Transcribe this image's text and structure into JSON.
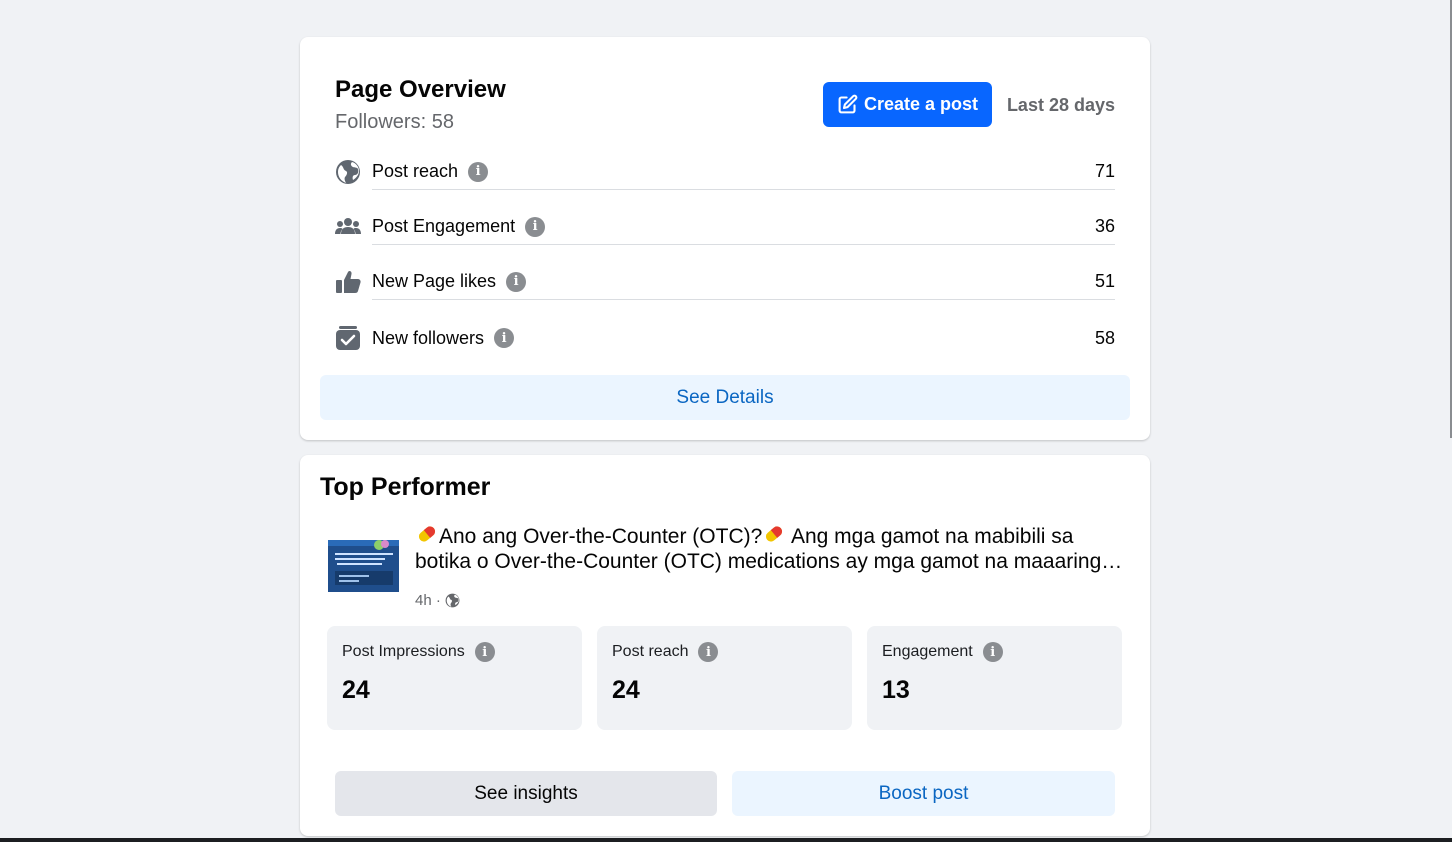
{
  "overview": {
    "title": "Page Overview",
    "subtitle": "Followers: 58",
    "create_post_label": "Create a post",
    "date_range": "Last 28 days",
    "metrics": [
      {
        "label": "Post reach",
        "value": "71",
        "icon": "globe-icon"
      },
      {
        "label": "Post Engagement",
        "value": "36",
        "icon": "people-icon"
      },
      {
        "label": "New Page likes",
        "value": "51",
        "icon": "thumbs-up-icon"
      },
      {
        "label": "New followers",
        "value": "58",
        "icon": "follow-check-icon"
      }
    ],
    "see_details_label": "See Details"
  },
  "top_performer": {
    "title": "Top Performer",
    "post_text_1": "Ano ang Over-the-Counter (OTC)?",
    "post_text_2": " Ang mga gamot na mabibili sa botika o Over-the-Counter (OTC) medications ay mga gamot na maaaring bilhin nang walang reseta ng doktor.",
    "post_time": "4h ·",
    "stats": [
      {
        "label": "Post Impressions",
        "value": "24"
      },
      {
        "label": "Post reach",
        "value": "24"
      },
      {
        "label": "Engagement",
        "value": "13"
      }
    ],
    "see_insights_label": "See insights",
    "boost_label": "Boost post"
  },
  "colors": {
    "primary": "#0866ff",
    "link": "#0a66c2",
    "secondary_text": "#65676b",
    "background": "#f0f2f5"
  }
}
